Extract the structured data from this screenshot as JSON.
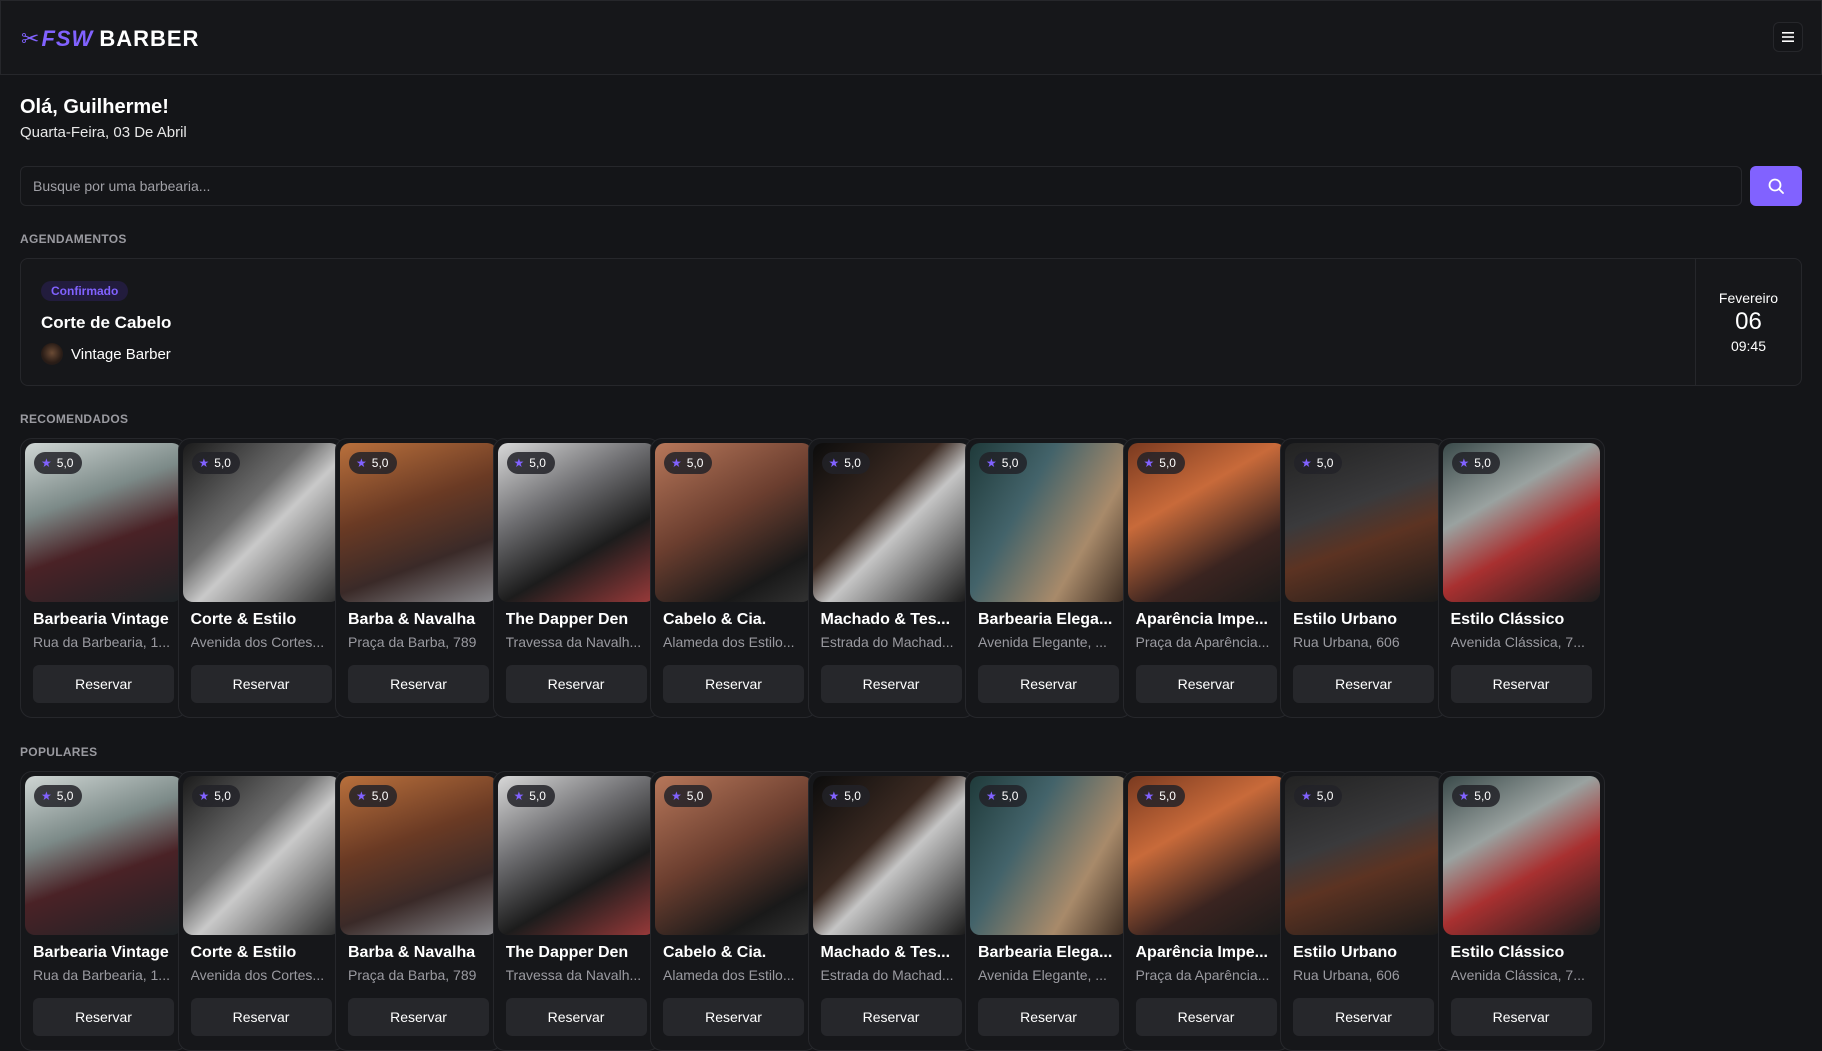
{
  "header": {
    "logo_primary": "FSW",
    "logo_secondary": "BARBER",
    "accent": "#8162ff"
  },
  "welcome": {
    "greeting": "Olá, Guilherme!",
    "date": "Quarta-Feira, 03 De Abril"
  },
  "search": {
    "placeholder": "Busque por uma barbearia..."
  },
  "bookings": {
    "title": "AGENDAMENTOS",
    "items": [
      {
        "status": "Confirmado",
        "service": "Corte de Cabelo",
        "barbershop": "Vintage Barber",
        "month": "Fevereiro",
        "day": "06",
        "time": "09:45"
      }
    ]
  },
  "recommended": {
    "title": "RECOMENDADOS",
    "cards": [
      {
        "rating": "5,0",
        "name": "Barbearia Vintage",
        "address": "Rua da Barbearia, 1...",
        "button": "Reservar"
      },
      {
        "rating": "5,0",
        "name": "Corte & Estilo",
        "address": "Avenida dos Cortes...",
        "button": "Reservar"
      },
      {
        "rating": "5,0",
        "name": "Barba & Navalha",
        "address": "Praça da Barba, 789",
        "button": "Reservar"
      },
      {
        "rating": "5,0",
        "name": "The Dapper Den",
        "address": "Travessa da Navalh...",
        "button": "Reservar"
      },
      {
        "rating": "5,0",
        "name": "Cabelo & Cia.",
        "address": "Alameda dos Estilo...",
        "button": "Reservar"
      },
      {
        "rating": "5,0",
        "name": "Machado & Tes...",
        "address": "Estrada do Machad...",
        "button": "Reservar"
      },
      {
        "rating": "5,0",
        "name": "Barbearia Elega...",
        "address": "Avenida Elegante, ...",
        "button": "Reservar"
      },
      {
        "rating": "5,0",
        "name": "Aparência Impe...",
        "address": "Praça da Aparência...",
        "button": "Reservar"
      },
      {
        "rating": "5,0",
        "name": "Estilo Urbano",
        "address": "Rua Urbana, 606",
        "button": "Reservar"
      },
      {
        "rating": "5,0",
        "name": "Estilo Clássico",
        "address": "Avenida Clássica, 7...",
        "button": "Reservar"
      }
    ]
  },
  "popular": {
    "title": "POPULARES",
    "cards": [
      {
        "rating": "5,0",
        "name": "Barbearia Vintage",
        "address": "Rua da Barbearia, 1...",
        "button": "Reservar"
      },
      {
        "rating": "5,0",
        "name": "Corte & Estilo",
        "address": "Avenida dos Cortes...",
        "button": "Reservar"
      },
      {
        "rating": "5,0",
        "name": "Barba & Navalha",
        "address": "Praça da Barba, 789",
        "button": "Reservar"
      },
      {
        "rating": "5,0",
        "name": "The Dapper Den",
        "address": "Travessa da Navalh...",
        "button": "Reservar"
      },
      {
        "rating": "5,0",
        "name": "Cabelo & Cia.",
        "address": "Alameda dos Estilo...",
        "button": "Reservar"
      },
      {
        "rating": "5,0",
        "name": "Machado & Tes...",
        "address": "Estrada do Machad...",
        "button": "Reservar"
      },
      {
        "rating": "5,0",
        "name": "Barbearia Elega...",
        "address": "Avenida Elegante, ...",
        "button": "Reservar"
      },
      {
        "rating": "5,0",
        "name": "Aparência Impe...",
        "address": "Praça da Aparência...",
        "button": "Reservar"
      },
      {
        "rating": "5,0",
        "name": "Estilo Urbano",
        "address": "Rua Urbana, 606",
        "button": "Reservar"
      },
      {
        "rating": "5,0",
        "name": "Estilo Clássico",
        "address": "Avenida Clássica, 7...",
        "button": "Reservar"
      }
    ]
  }
}
